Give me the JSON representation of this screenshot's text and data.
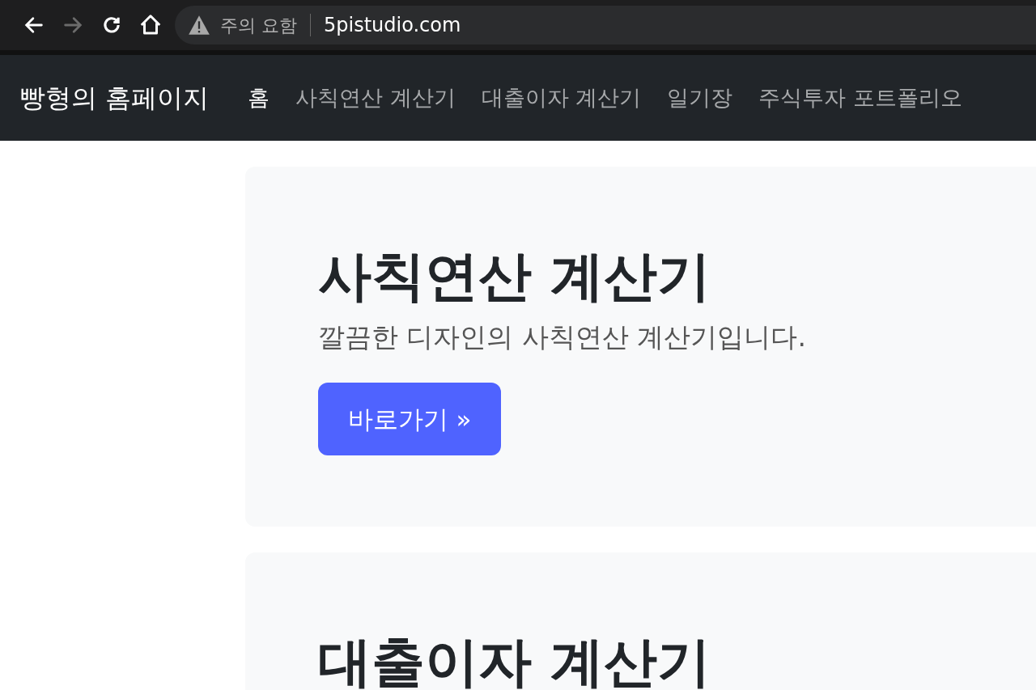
{
  "browser": {
    "back": {
      "disabled": false
    },
    "forward": {
      "disabled": true
    },
    "security_label": "주의 요함",
    "url": "5pistudio.com"
  },
  "navbar": {
    "brand": "빵형의 홈페이지",
    "items": [
      {
        "label": "홈",
        "selected": true
      },
      {
        "label": "사칙연산 계산기",
        "selected": false
      },
      {
        "label": "대출이자 계산기",
        "selected": false
      },
      {
        "label": "일기장",
        "selected": false
      },
      {
        "label": "주식투자 포트폴리오",
        "selected": false
      }
    ]
  },
  "cards": [
    {
      "title": "사칙연산 계산기",
      "description": "깔끔한 디자인의 사칙연산 계산기입니다.",
      "button": "바로가기 »"
    },
    {
      "title": "대출이자 계산기"
    }
  ]
}
